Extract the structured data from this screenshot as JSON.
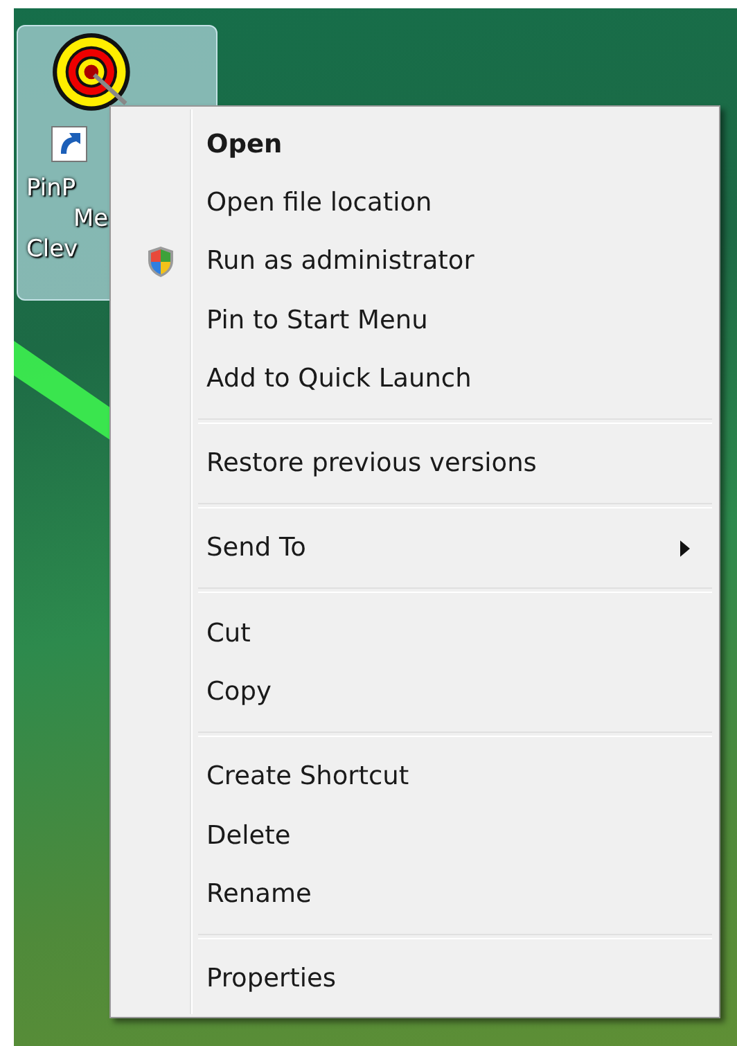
{
  "desktop_icon": {
    "label_lines": [
      "PinP",
      "Me",
      "Clev"
    ],
    "selected": true
  },
  "context_menu": {
    "groups": [
      [
        {
          "label": "Open",
          "kind": "default"
        },
        {
          "label": "Open file location",
          "kind": "normal"
        },
        {
          "label": "Run as administrator",
          "kind": "admin"
        },
        {
          "label": "Pin to Start Menu",
          "kind": "normal"
        },
        {
          "label": "Add to Quick Launch",
          "kind": "normal"
        }
      ],
      [
        {
          "label": "Restore previous versions",
          "kind": "normal"
        }
      ],
      [
        {
          "label": "Send To",
          "kind": "submenu"
        }
      ],
      [
        {
          "label": "Cut",
          "kind": "normal"
        },
        {
          "label": "Copy",
          "kind": "normal"
        }
      ],
      [
        {
          "label": "Create Shortcut",
          "kind": "normal"
        },
        {
          "label": "Delete",
          "kind": "normal"
        },
        {
          "label": "Rename",
          "kind": "normal"
        }
      ],
      [
        {
          "label": "Properties",
          "kind": "normal"
        }
      ]
    ]
  }
}
